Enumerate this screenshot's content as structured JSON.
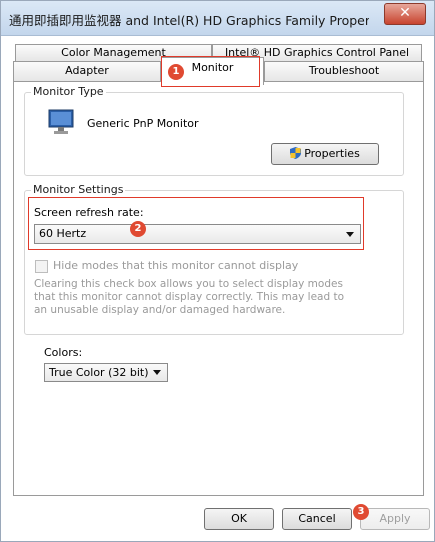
{
  "window": {
    "title": "通用即插即用监视器 and Intel(R) HD Graphics Family Properties",
    "close_icon": "close-icon"
  },
  "tabs": {
    "row1": [
      {
        "label": "Color Management"
      },
      {
        "label": "Intel® HD Graphics Control Panel"
      }
    ],
    "row2": [
      {
        "label": "Adapter"
      },
      {
        "label": "Monitor",
        "active": true
      },
      {
        "label": "Troubleshoot"
      }
    ]
  },
  "monitor_type": {
    "group_label": "Monitor Type",
    "icon": "monitor-icon",
    "name": "Generic PnP Monitor",
    "properties_button": "Properties",
    "properties_icon": "shield-icon"
  },
  "monitor_settings": {
    "group_label": "Monitor Settings",
    "refresh_label": "Screen refresh rate:",
    "refresh_value": "60 Hertz",
    "hide_modes_label": "Hide modes that this monitor cannot display",
    "hide_modes_checked": false,
    "help_text": "Clearing this check box allows you to select display modes that this monitor cannot display correctly. This may lead to an unusable display and/or damaged hardware."
  },
  "colors": {
    "label": "Colors:",
    "value": "True Color (32 bit)"
  },
  "footer": {
    "ok": "OK",
    "cancel": "Cancel",
    "apply": "Apply"
  },
  "annotations": {
    "badge1": "1",
    "badge2": "2",
    "badge3": "3",
    "accent_color": "#e03a2a"
  }
}
